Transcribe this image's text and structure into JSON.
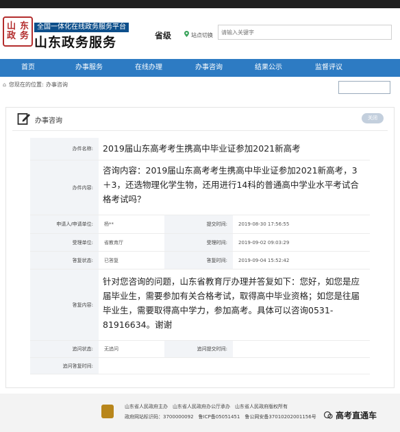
{
  "header": {
    "logo_glyphs": [
      "山",
      "东",
      "政",
      "务"
    ],
    "tagline": "全国一体化在线政务服务平台",
    "site_name": "山东政务服务",
    "province": "省级",
    "site_switch": "站点切换",
    "search_placeholder": "请输入关键字"
  },
  "nav": {
    "items": [
      "首页",
      "办事服务",
      "在线办理",
      "办事咨询",
      "结果公示",
      "监督评议"
    ]
  },
  "breadcrumb": {
    "label": "您现在的位置:",
    "current": "办事咨询"
  },
  "panel": {
    "title": "办事咨询",
    "back_label": "关闭"
  },
  "detail": {
    "item_name_label": "办件名称:",
    "item_name": "2019届山东高考考生携高中毕业证参加2021新高考",
    "content_label": "办件内容:",
    "content": "咨询内容：2019届山东高考考生携高中毕业证参加2021新高考，3＋3，还选物理化学生物，还用进行14科的普通高中学业水平考试合格考试吗？",
    "applicant_label": "申请人/申请单位:",
    "applicant": "杨**",
    "submit_time_label": "提交时间:",
    "submit_time": "2019-08-30 17:56:55",
    "accept_unit_label": "受理单位:",
    "accept_unit": "省教育厅",
    "accept_time_label": "受理时间:",
    "accept_time": "2019-09-02 09:03:29",
    "reply_status_label": "答复状态:",
    "reply_status": "已答复",
    "reply_time_label": "答复时间:",
    "reply_time": "2019-09-04 15:52:42",
    "reply_content_label": "答复内容:",
    "reply_content": "针对您咨询的问题，山东省教育厅办理并答复如下：您好，如您是应届毕业生，需要参加有关合格考试，取得高中毕业资格；如您是往届毕业生，需要取得高中学力，参加高考。具体可以咨询0531-81916634。谢谢",
    "followup_status_label": "追问状态:",
    "followup_status": "无追问",
    "followup_submit_label": "追问提交时间:",
    "followup_submit": "",
    "followup_reply_label": "追问答复时间:",
    "followup_reply": ""
  },
  "footer": {
    "line1": "山东省人民政府主办　山东省人民政府办公厅承办　山东省人民政府版权所有",
    "line2": "政府网站标识码：3700000092　鲁ICP备05051451　鲁公网安备37010202001156号",
    "wechat_name": "高考直通车"
  },
  "colors": {
    "nav_blue": "#2d7bc3",
    "brand_dark_blue": "#0d4f8b",
    "seal_red": "#b32c2c"
  }
}
